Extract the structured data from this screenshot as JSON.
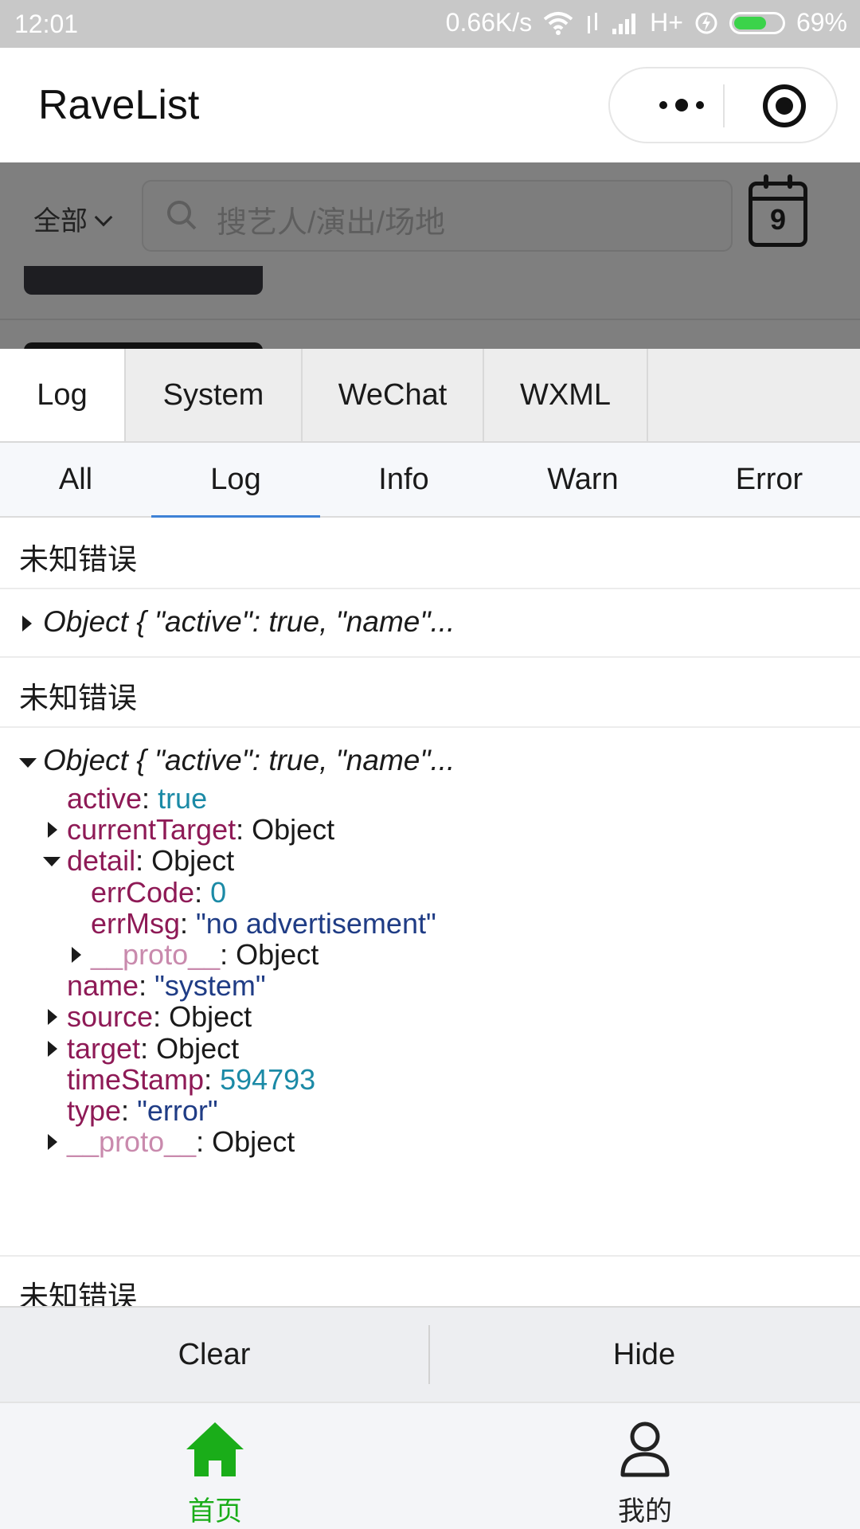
{
  "status_bar": {
    "time": "12:01",
    "network_speed": "0.66K/s",
    "network_type": "H+",
    "battery_percent": "69%",
    "battery_level": 0.69,
    "icons": [
      "wifi-icon",
      "data-arrows-icon",
      "signal-icon",
      "charging-icon",
      "battery-icon"
    ]
  },
  "nav": {
    "title": "RaveList",
    "icons": [
      "more-dots-icon",
      "close-target-icon"
    ]
  },
  "filter": {
    "selected": "全部"
  },
  "search": {
    "placeholder": "搜艺人/演出/场地"
  },
  "calendar": {
    "day": "9"
  },
  "console": {
    "tabs": [
      "Log",
      "System",
      "WeChat",
      "WXML"
    ],
    "active_tab": "Log",
    "subtabs": [
      "All",
      "Log",
      "Info",
      "Warn",
      "Error"
    ],
    "active_subtab": "Log",
    "logs": [
      {
        "type": "text",
        "text": "未知错误"
      },
      {
        "type": "object",
        "summary": "Object { \"active\": true, \"name\"...",
        "expanded": false
      },
      {
        "type": "text",
        "text": "未知错误"
      },
      {
        "type": "object",
        "summary": "Object { \"active\": true, \"name\"...",
        "expanded": true,
        "props": [
          {
            "key": "active",
            "sep": ": ",
            "value": "true",
            "vtype": "bool"
          },
          {
            "key": "currentTarget",
            "sep": ": ",
            "value": "Object",
            "vtype": "obj",
            "expandable": true
          },
          {
            "key": "detail",
            "sep": ": ",
            "value": "Object",
            "vtype": "obj",
            "expandable": true,
            "expanded": true
          },
          {
            "key": "errCode",
            "sep": ": ",
            "value": "0",
            "vtype": "num"
          },
          {
            "key": "errMsg",
            "sep": ": ",
            "value": "\"no advertisement\"",
            "vtype": "str"
          },
          {
            "key": "__proto__",
            "sep": ": ",
            "value": "Object",
            "vtype": "obj",
            "expandable": true
          },
          {
            "key": "name",
            "sep": ": ",
            "value": "\"system\"",
            "vtype": "str"
          },
          {
            "key": "source",
            "sep": ": ",
            "value": "Object",
            "vtype": "obj",
            "expandable": true
          },
          {
            "key": "target",
            "sep": ": ",
            "value": "Object",
            "vtype": "obj",
            "expandable": true
          },
          {
            "key": "timeStamp",
            "sep": ": ",
            "value": "594793",
            "vtype": "num"
          },
          {
            "key": "type",
            "sep": ": ",
            "value": "\"error\"",
            "vtype": "str"
          },
          {
            "key": "__proto__",
            "sep": ": ",
            "value": "Object",
            "vtype": "obj",
            "expandable": true
          }
        ]
      },
      {
        "type": "text",
        "text": "未知错误"
      }
    ],
    "buttons": {
      "clear": "Clear",
      "hide": "Hide"
    }
  },
  "tabbar": {
    "items": [
      {
        "label": "首页",
        "icon": "home-icon",
        "active": true
      },
      {
        "label": "我的",
        "icon": "user-icon",
        "active": false
      }
    ]
  },
  "colors": {
    "accent_green": "#1aad19",
    "active_underline": "#3e82d6",
    "key": "#8e1a56",
    "number": "#1b8aa6",
    "string": "#1f3c85"
  }
}
